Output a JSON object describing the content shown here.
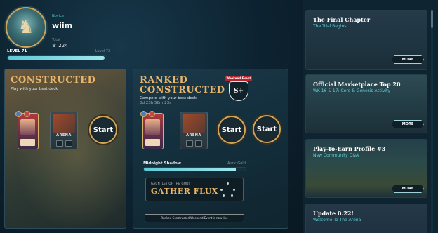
{
  "profile": {
    "rank": "Novice",
    "username": "wiim",
    "total_label": "Total",
    "total_value": "224",
    "level_label": "LEVEL 71",
    "level_next": "Level 72",
    "level_progress": 0.98
  },
  "constructed": {
    "title": "CONSTRUCTED",
    "subtitle": "Play with your best deck",
    "arena_label": "ARENA",
    "start_label": "Start"
  },
  "ranked": {
    "title_line1": "RANKED",
    "title_line2": "CONSTRUCTED",
    "subtitle": "Compete with your best deck",
    "timer": "0d 23h 56m 23s",
    "event_badge": "Weekend Event",
    "arena_label": "ARENA",
    "start_label": "Start",
    "start_label_outer": "Start",
    "league_current": "Midnight Shadow",
    "league_next": "Auric Gold",
    "league_progress": 0.9,
    "gauntlet_top": "GAUNTLET OF THE GODS",
    "gauntlet_title": "GATHER FLUX",
    "notice": "Ranked Constructed Weekend Event is now live"
  },
  "news": [
    {
      "title": "The Final Chapter",
      "subtitle": "The Trial Begins",
      "more": "MORE"
    },
    {
      "title": "Official Marketplace Top 20",
      "subtitle": "WK 16 & 17: Core & Genesis Activity",
      "more": "MORE"
    },
    {
      "title": "Play-To-Earn Profile #3",
      "subtitle": "New Community Q&A",
      "more": "MORE"
    },
    {
      "title": "Update 0.22!",
      "subtitle": "Welcome To The Arena"
    }
  ]
}
